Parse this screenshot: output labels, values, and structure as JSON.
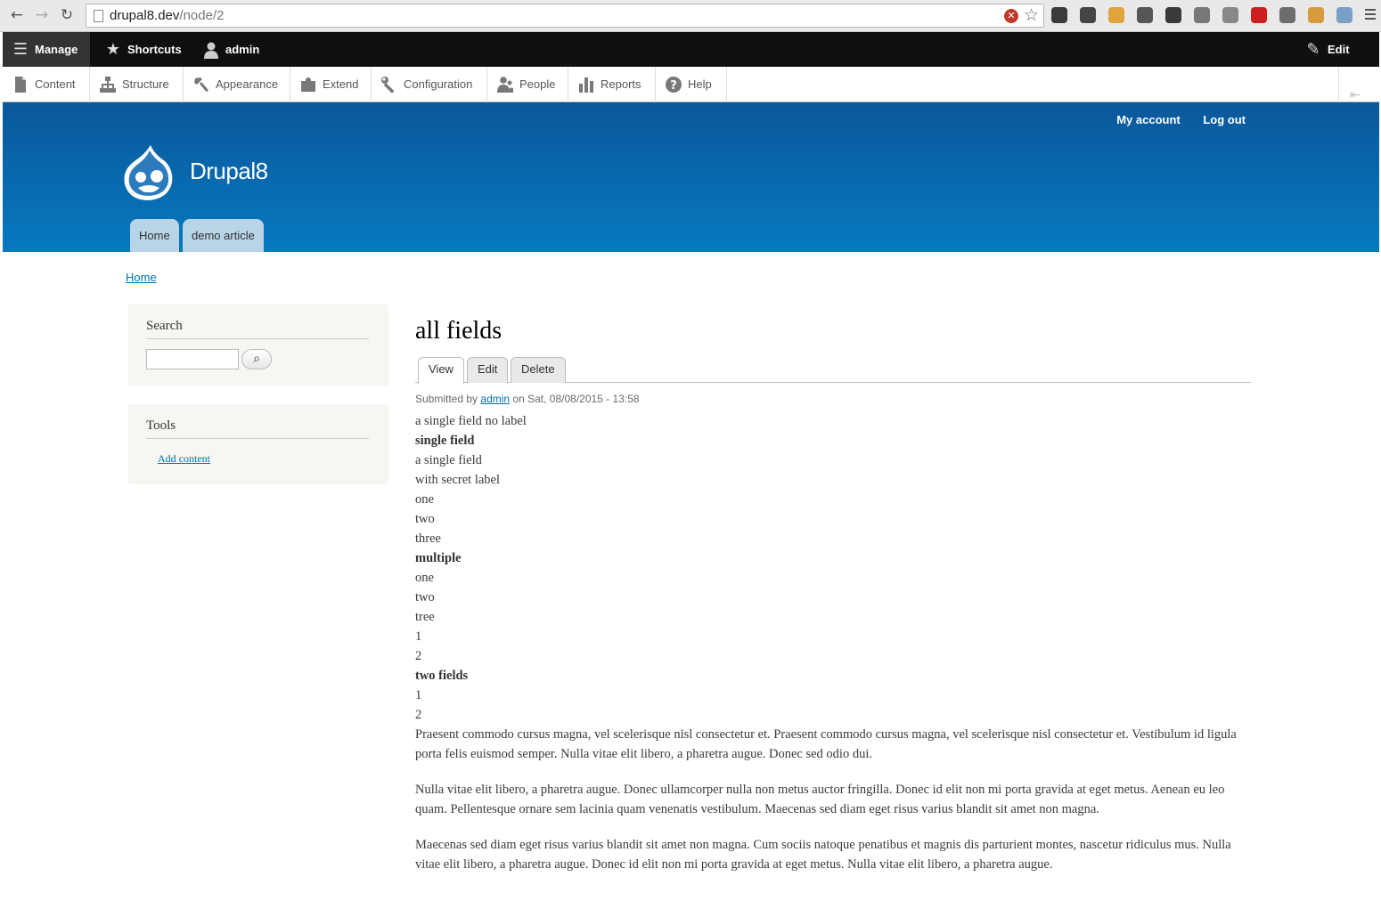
{
  "browser": {
    "url_host": "drupal8.dev",
    "url_path": "/node/2",
    "extension_colors": [
      "#3b3b3b",
      "#444444",
      "#e0a43a",
      "#555555",
      "#3a3a3a",
      "#777777",
      "#888888",
      "#cc1f1f",
      "#6d6d6d",
      "#d99a3c",
      "#7aa0c8",
      "#d65bc4"
    ]
  },
  "toolbar": {
    "manage": "Manage",
    "shortcuts": "Shortcuts",
    "user": "admin",
    "edit": "Edit"
  },
  "tray": {
    "items": [
      {
        "label": "Content",
        "icon": "file-icon"
      },
      {
        "label": "Structure",
        "icon": "sitemap-icon"
      },
      {
        "label": "Appearance",
        "icon": "paintbrush-icon"
      },
      {
        "label": "Extend",
        "icon": "puzzle-icon"
      },
      {
        "label": "Configuration",
        "icon": "wrench-icon"
      },
      {
        "label": "People",
        "icon": "people-icon"
      },
      {
        "label": "Reports",
        "icon": "bar-chart-icon"
      },
      {
        "label": "Help",
        "icon": "help-icon"
      }
    ]
  },
  "header": {
    "secondary_menu": [
      "My account",
      "Log out"
    ],
    "site_name": "Drupal8",
    "main_menu": [
      "Home",
      "demo article"
    ],
    "colors": {
      "top": "#0a579a",
      "bottom": "#0779bf",
      "tab": "#b9d3e7"
    }
  },
  "breadcrumb": "Home",
  "sidebar": {
    "search_title": "Search",
    "search_value": "",
    "tools_title": "Tools",
    "tools_link": "Add content"
  },
  "node": {
    "title": "all fields",
    "tabs": [
      "View",
      "Edit",
      "Delete"
    ],
    "submitted_prefix": "Submitted by",
    "author": "admin",
    "submitted_suffix": "on Sat, 08/08/2015 - 13:58",
    "fields": [
      {
        "text": "a single field no label",
        "label": false
      },
      {
        "text": "single field",
        "label": true
      },
      {
        "text": "a single field",
        "label": false
      },
      {
        "text": "with secret label",
        "label": false
      },
      {
        "text": "one",
        "label": false
      },
      {
        "text": "two",
        "label": false
      },
      {
        "text": "three",
        "label": false
      },
      {
        "text": "multiple",
        "label": true
      },
      {
        "text": "one",
        "label": false
      },
      {
        "text": "two",
        "label": false
      },
      {
        "text": "tree",
        "label": false
      },
      {
        "text": "1",
        "label": false
      },
      {
        "text": "2",
        "label": false
      },
      {
        "text": "two fields",
        "label": true
      },
      {
        "text": "1",
        "label": false
      },
      {
        "text": "2",
        "label": false
      }
    ],
    "body": [
      "Praesent commodo cursus magna, vel scelerisque nisl consectetur et. Praesent commodo cursus magna, vel scelerisque nisl consectetur et. Vestibulum id ligula porta felis euismod semper. Nulla vitae elit libero, a pharetra augue. Donec sed odio dui.",
      "Nulla vitae elit libero, a pharetra augue. Donec ullamcorper nulla non metus auctor fringilla. Donec id elit non mi porta gravida at eget metus. Aenean eu leo quam. Pellentesque ornare sem lacinia quam venenatis vestibulum. Maecenas sed diam eget risus varius blandit sit amet non magna.",
      "Maecenas sed diam eget risus varius blandit sit amet non magna. Cum sociis natoque penatibus et magnis dis parturient montes, nascetur ridiculus mus. Nulla vitae elit libero, a pharetra augue. Donec id elit non mi porta gravida at eget metus. Nulla vitae elit libero, a pharetra augue."
    ]
  }
}
